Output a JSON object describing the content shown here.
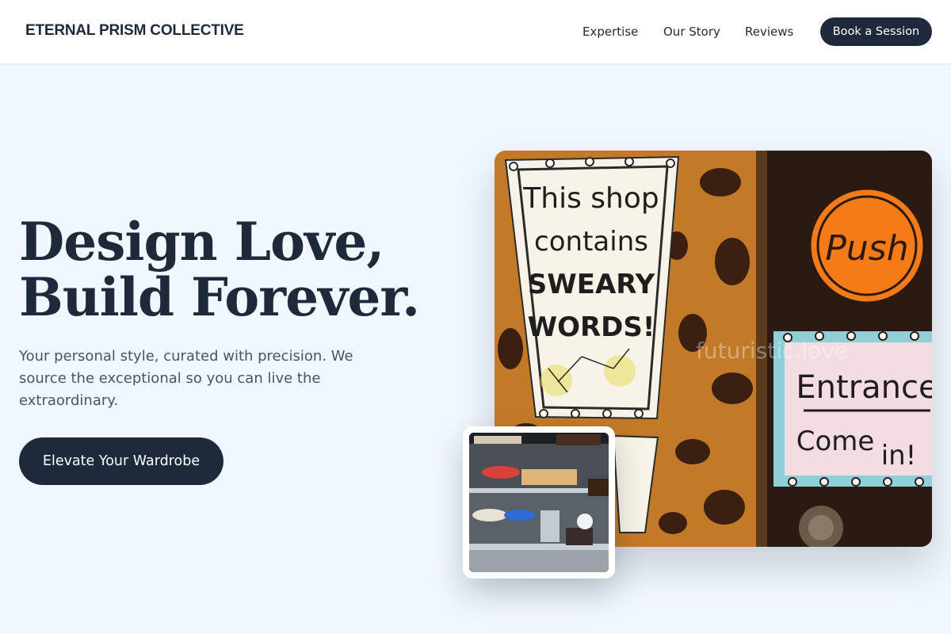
{
  "header": {
    "brand": "ETERNAL PRISM COLLECTIVE",
    "nav": [
      "Expertise",
      "Our Story",
      "Reviews"
    ],
    "cta_label": "Book a Session"
  },
  "hero": {
    "title_line1": "Design Love,",
    "title_line2": "Build Forever.",
    "subtitle": "Your personal style, curated with precision. We source the exceptional so you can live the extraordinary.",
    "cta_label": "Elevate Your Wardrobe"
  },
  "main_image": {
    "sign_left": [
      "This shop",
      "contains",
      "SWEARY",
      "WORDS!"
    ],
    "sign_push": "Push",
    "sign_entrance": [
      "Entrance",
      "Come",
      "in!"
    ],
    "watermark": "futuristic.love"
  },
  "colors": {
    "primary": "#1e293b",
    "background": "#f0f7fd",
    "text_muted": "#475569"
  }
}
